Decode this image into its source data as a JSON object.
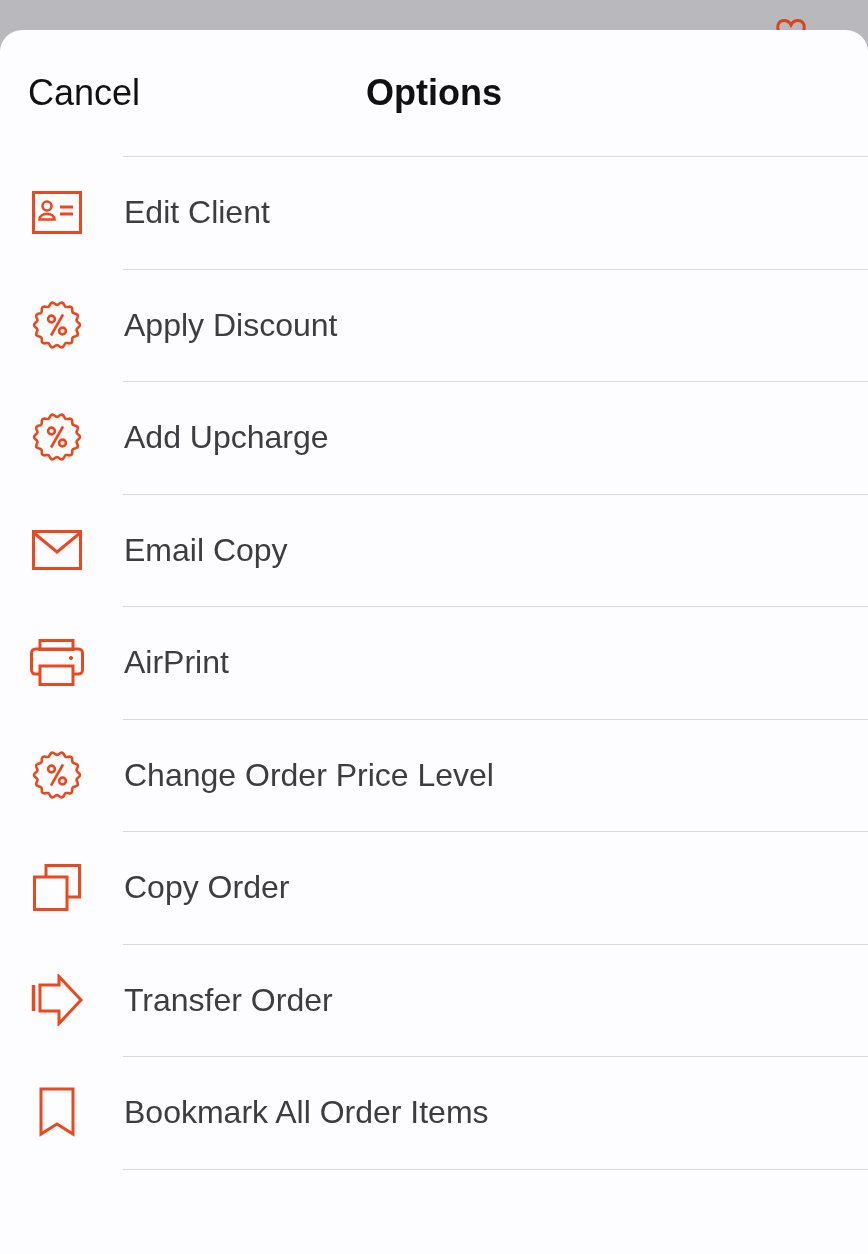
{
  "header": {
    "cancel": "Cancel",
    "title": "Options"
  },
  "items": [
    {
      "kind": "client",
      "label": "Edit Client"
    },
    {
      "kind": "discount",
      "label": "Apply Discount"
    },
    {
      "kind": "discount",
      "label": "Add Upcharge"
    },
    {
      "kind": "email",
      "label": "Email Copy"
    },
    {
      "kind": "print",
      "label": "AirPrint"
    },
    {
      "kind": "discount",
      "label": "Change Order Price Level"
    },
    {
      "kind": "copy",
      "label": "Copy Order"
    },
    {
      "kind": "transfer",
      "label": "Transfer Order"
    },
    {
      "kind": "bookmark",
      "label": "Bookmark All Order Items"
    }
  ]
}
